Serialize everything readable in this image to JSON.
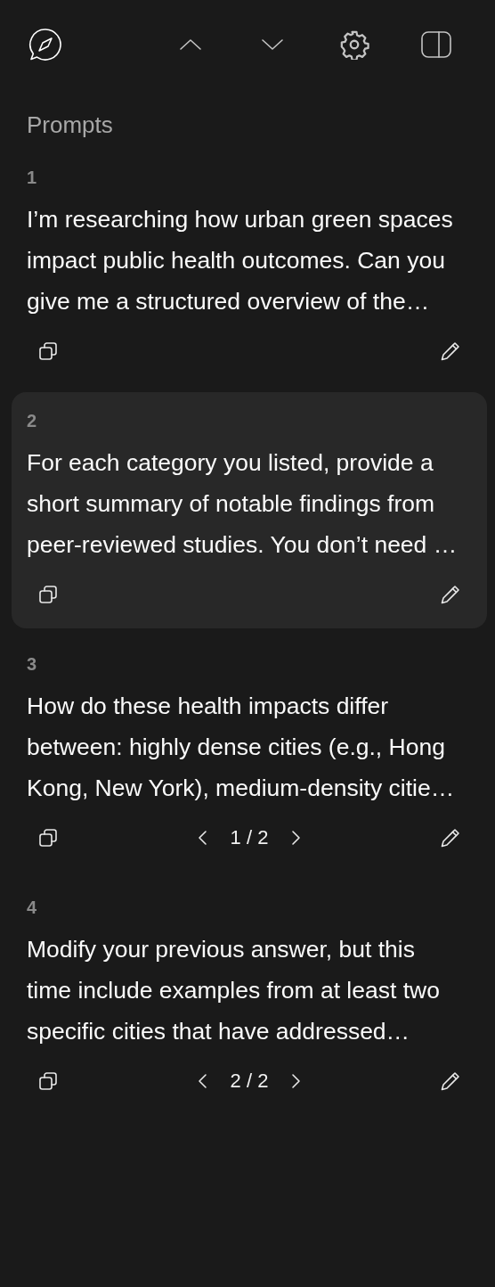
{
  "toolbar": {
    "buttons": [
      {
        "kind": "logo"
      },
      {
        "kind": "up"
      },
      {
        "kind": "down"
      },
      {
        "kind": "settings"
      },
      {
        "kind": "sidebar"
      }
    ]
  },
  "section_title": "Prompts",
  "prompts": [
    {
      "number": "1",
      "selected": false,
      "lines": [
        "I’m researching how urban green spaces",
        "impact public health outcomes. Can you",
        "give me a structured overview of the…"
      ]
    },
    {
      "number": "2",
      "selected": true,
      "lines": [
        "For each category you listed, provide a",
        "short summary of notable findings from",
        "peer-reviewed studies. You don’t need …"
      ]
    },
    {
      "number": "3",
      "selected": false,
      "lines": [
        "How do these health impacts differ",
        "between: highly dense cities (e.g., Hong",
        "Kong, New York), medium-density citie…"
      ],
      "pager": "1 / 2"
    },
    {
      "number": "4",
      "selected": false,
      "lines": [
        "Modify your previous answer, but this",
        "time include examples from at least two",
        "specific cities that have addressed…"
      ],
      "pager": "2 / 2"
    }
  ]
}
